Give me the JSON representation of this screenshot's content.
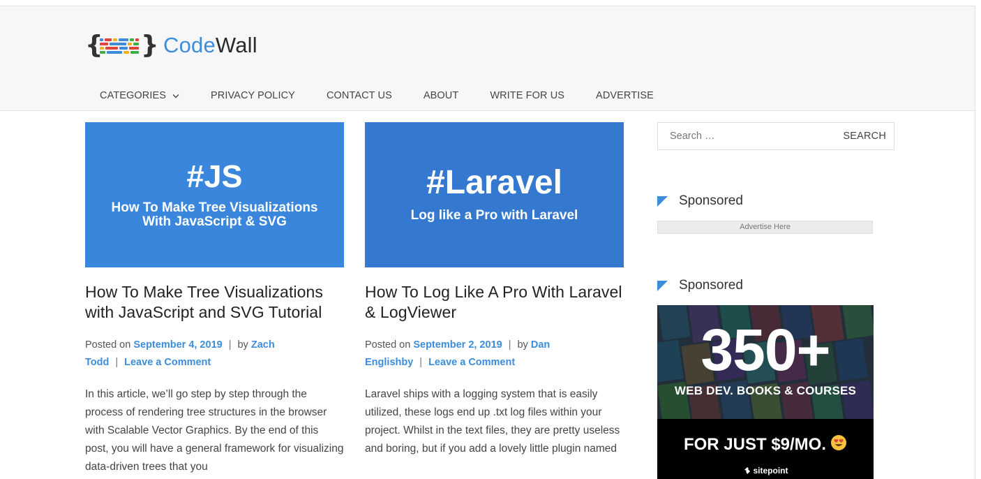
{
  "site": {
    "logo_part1": "Code",
    "logo_part2": "Wall",
    "brand_colors": {
      "blue": "#3d8ddb",
      "red": "#e0433b",
      "yellow": "#f2b01e",
      "green": "#3fae49"
    }
  },
  "nav": {
    "items": [
      {
        "label": "CATEGORIES",
        "icon": "chevron-down-icon"
      },
      {
        "label": "PRIVACY POLICY"
      },
      {
        "label": "CONTACT US"
      },
      {
        "label": "ABOUT"
      },
      {
        "label": "WRITE FOR US"
      },
      {
        "label": "ADVERTISE"
      }
    ]
  },
  "posts": [
    {
      "thumb_tag": "#JS",
      "thumb_line1": "How To Make Tree Visualizations",
      "thumb_line2": "With JavaScript & SVG",
      "title": "How To Make Tree Visualizations with JavaScript and SVG Tutorial",
      "posted_on": "Posted on",
      "date": "September 4, 2019",
      "by": "by",
      "author_first": "Zach",
      "author_last": "Todd",
      "comment": "Leave a Comment",
      "excerpt": "In this article, we’ll go step by step through the process of rendering tree structures in the browser with Scalable Vector Graphics.  By the end of this post, you will have a general framework for visualizing data-driven trees that you"
    },
    {
      "thumb_tag": "#Laravel",
      "thumb_line1": "Log like a Pro with Laravel",
      "title": "How To Log Like A Pro With Laravel & LogViewer",
      "posted_on": "Posted on",
      "date": "September 2, 2019",
      "by": "by",
      "author_first": "Dan",
      "author_last": "Englishby",
      "comment": "Leave a Comment",
      "excerpt": "Laravel ships with a logging system that is easily utilized, these logs end up .txt log files within your project. Whilst in the text files, they are pretty useless and boring, but if you add a lovely little plugin named"
    }
  ],
  "sidebar": {
    "search_placeholder": "Search …",
    "search_button": "SEARCH",
    "sponsored_1": "Sponsored",
    "ad_slot": "Advertise Here",
    "sponsored_2": "Sponsored",
    "banner": {
      "big": "350+",
      "line1": "WEB DEV. BOOKS & COURSES",
      "line2": "FOR JUST $9/MO.",
      "brand": "sitepoint"
    }
  }
}
